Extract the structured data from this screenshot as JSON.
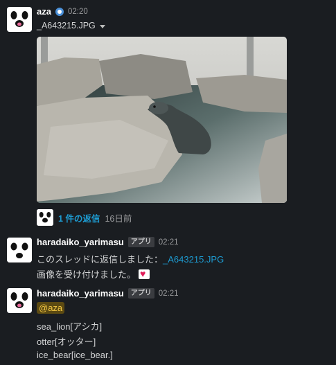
{
  "messages": [
    {
      "user": "aza",
      "time": "02:20",
      "file": {
        "name": "_A643215.JPG"
      },
      "thread": {
        "count_label": "1 件の返信",
        "age_label": "16日前"
      }
    },
    {
      "user": "haradaiko_yarimasu",
      "badge": "アプリ",
      "time": "02:21",
      "text1_prefix": "このスレッドに返信しました：",
      "text1_link": "_A643215.JPG",
      "text2": "画像を受け付けました。"
    },
    {
      "user": "haradaiko_yarimasu",
      "badge": "アプリ",
      "time": "02:21",
      "mention": "@aza",
      "lines": [
        "sea_lion[アシカ]",
        "otter[オッター]",
        "ice_bear[ice_bear.]"
      ]
    }
  ],
  "icons": {
    "avatar": "panda-face-icon",
    "status": "status-emoji-icon",
    "caret": "chevron-down-icon",
    "heart": "heart-icon"
  }
}
